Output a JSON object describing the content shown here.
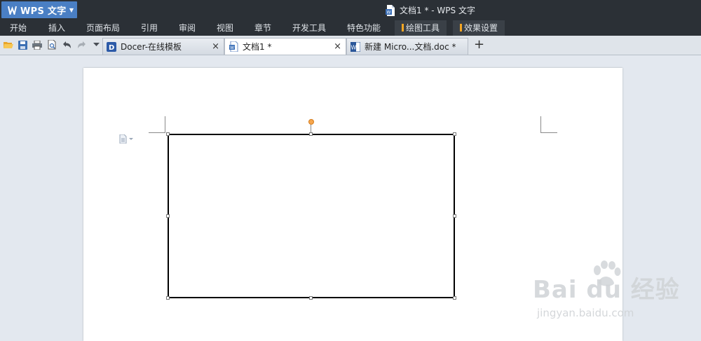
{
  "app": {
    "name": "WPS 文字",
    "window_title": "文档1 * - WPS 文字"
  },
  "menu": [
    "开始",
    "插入",
    "页面布局",
    "引用",
    "审阅",
    "视图",
    "章节",
    "开发工具",
    "特色功能"
  ],
  "menu_highlight": [
    "绘图工具",
    "效果设置"
  ],
  "toolbar_icons": [
    "open-folder-icon",
    "save-icon",
    "print-icon",
    "print-preview-icon",
    "undo-icon",
    "redo-icon",
    "quick-access-dropdown-icon"
  ],
  "tabs": [
    {
      "label": "Docer-在线模板",
      "close": "×",
      "icon": "docer-icon",
      "active": false
    },
    {
      "label": "文档1 *",
      "close": "×",
      "icon": "wps-doc-icon",
      "active": true
    },
    {
      "label": "新建 Micro...文档.doc *",
      "close": "×",
      "icon": "word-doc-icon",
      "active": false
    }
  ],
  "new_tab": "+",
  "watermark": {
    "brand": "Bai du 经验",
    "url": "jingyan.baidu.com"
  },
  "colors": {
    "titlebar": "#2b3036",
    "accent": "#4a7fc4",
    "highlight": "#f5a623",
    "rotate_handle": "#f6a64e"
  }
}
